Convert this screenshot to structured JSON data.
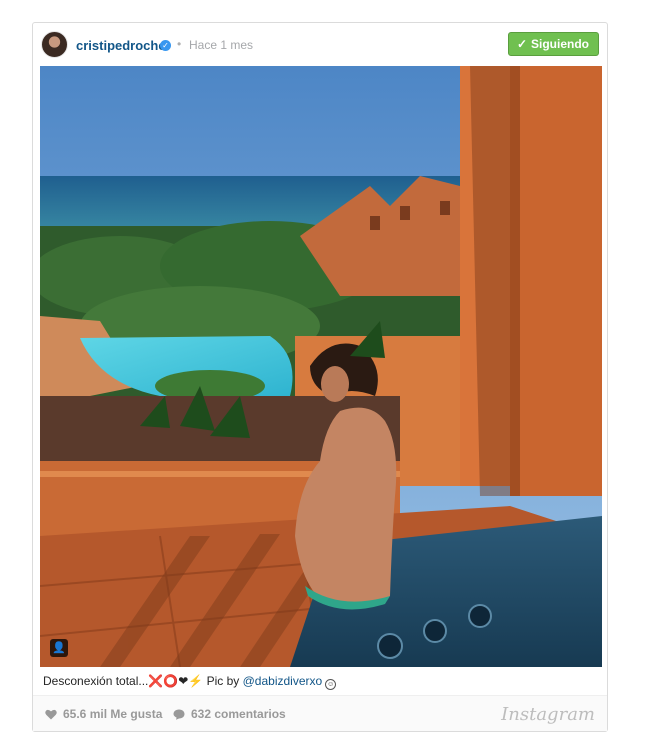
{
  "post": {
    "username": "cristipedroche",
    "separator": "•",
    "timestamp": "Hace 1 mes",
    "follow_label": "Siguiendo",
    "caption_text": "Desconexión total...❌⭕❤⚡ Pic by ",
    "caption_mention": "@dabizdiverxo",
    "caption_emoji": "😀",
    "likes": "65.6 mil Me gusta",
    "comments": "632 comentarios",
    "brand": "Instagram"
  },
  "icons": {
    "verified": "verified-badge-icon",
    "follow": "check-icon",
    "tag": "user-tag-icon",
    "likes": "heart-icon",
    "comments": "comment-bubble-icon"
  },
  "colors": {
    "username": "#125688",
    "follow_button": "#70c050",
    "verified": "#3897f0",
    "meta_text": "#999999"
  }
}
